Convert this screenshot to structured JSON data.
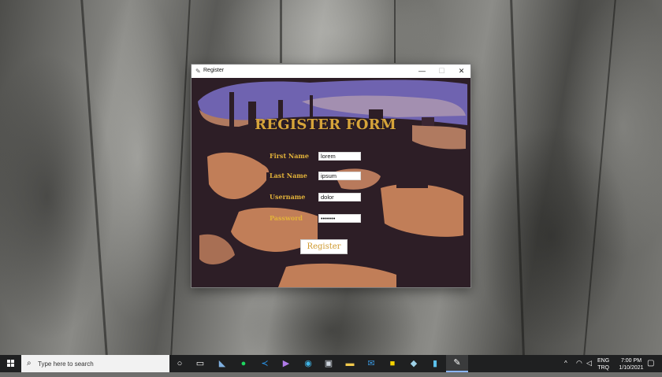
{
  "window": {
    "title": "Register",
    "controls": {
      "minimize": "—",
      "maximize": "☐",
      "close": "✕"
    }
  },
  "form": {
    "title": "REGISTER FORM",
    "fields": [
      {
        "label": "First Name",
        "value": "lorem"
      },
      {
        "label": "Last Name",
        "value": "ipsum"
      },
      {
        "label": "Username",
        "value": "dolor"
      },
      {
        "label": "Password",
        "value": "•••••••"
      }
    ],
    "submit_label": "Register"
  },
  "taskbar": {
    "search_placeholder": "Type here to search",
    "apps": [
      "cortana-icon",
      "task-view-icon",
      "app-icon",
      "spotify-icon",
      "vscode-icon",
      "visual-studio-icon",
      "edge-icon",
      "camera-icon",
      "file-explorer-icon",
      "mail-icon",
      "sticky-notes-icon",
      "app-icon",
      "app-icon",
      "register-app-icon"
    ],
    "tray": {
      "language": "ENG",
      "region": "TRQ",
      "time": "7:00 PM",
      "date": "1/10/2021"
    }
  },
  "colors": {
    "form_gold": "#d6a43a",
    "window_bg": "#2d1e26",
    "sky": "#6f63b0",
    "orange": "#c17e58",
    "taskbar": "#1f2021"
  }
}
